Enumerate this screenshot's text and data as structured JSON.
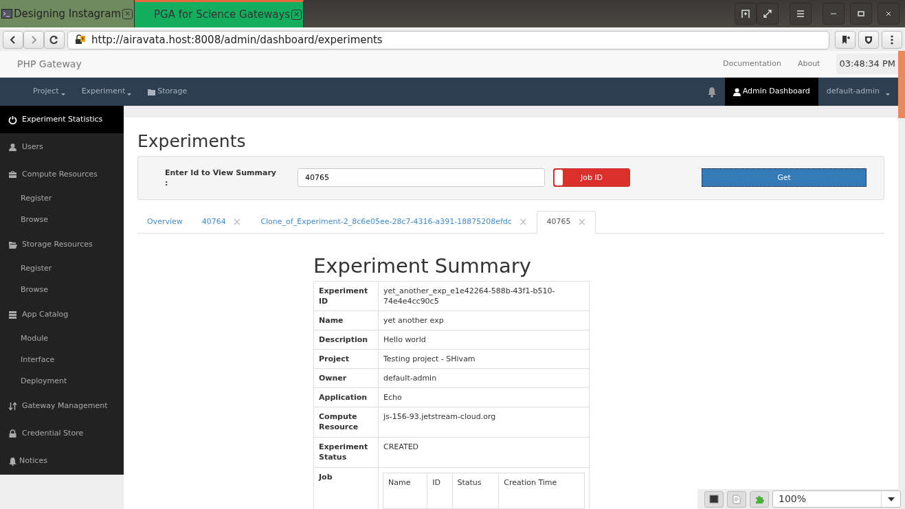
{
  "browser": {
    "tabs": [
      {
        "label": "Designing Instagram",
        "selected": false,
        "close": "×"
      },
      {
        "label": "PGA for Science Gateways",
        "selected": true,
        "close": "×"
      }
    ],
    "url": "http://airavata.host:8008/admin/dashboard/experiments"
  },
  "header": {
    "brand": "PHP Gateway",
    "links": [
      "Documentation",
      "About"
    ],
    "clock": "03:48:34 PM"
  },
  "navbar": {
    "left": [
      {
        "label": "Project",
        "kind": "dropdown"
      },
      {
        "label": "Experiment",
        "kind": "dropdown"
      },
      {
        "label": "Storage",
        "kind": "folder"
      }
    ],
    "right": [
      {
        "label": "Admin Dashboard",
        "kind": "user",
        "selected": true
      },
      {
        "label": "default-admin",
        "kind": "dropdown",
        "selected": false
      }
    ]
  },
  "sidebar": {
    "items": [
      {
        "label": "Experiment Statistics",
        "selected": true
      },
      {
        "label": "Users",
        "selected": false
      },
      {
        "label": "Compute Resources",
        "selected": false,
        "children": [
          {
            "label": "Register",
            "selected": false
          },
          {
            "label": "Browse",
            "selected": false
          }
        ]
      },
      {
        "label": "Storage Resources",
        "selected": false,
        "children": [
          {
            "label": "Register",
            "selected": false
          },
          {
            "label": "Browse",
            "selected": false
          }
        ]
      },
      {
        "label": "App Catalog",
        "selected": false,
        "children": [
          {
            "label": "Module",
            "selected": false
          },
          {
            "label": "Interface",
            "selected": false
          },
          {
            "label": "Deployment",
            "selected": false
          }
        ]
      },
      {
        "label": "Gateway Management",
        "selected": false
      },
      {
        "label": "Credential Store",
        "selected": false
      },
      {
        "label": "Notices",
        "selected": false
      }
    ]
  },
  "page": {
    "title": "Experiments",
    "search": {
      "label": "Enter Id to View Summary :",
      "value": "40765",
      "toggle": {
        "label": "Job ID",
        "on": false
      },
      "button": "Get"
    },
    "tabs": [
      {
        "label": "Overview",
        "selected": false
      },
      {
        "label": "40764",
        "selected": false,
        "close": "×"
      },
      {
        "label": "Clone_of_Experiment-2_8c6e05ee-28c7-4316-a391-18875208efdc",
        "selected": false,
        "close": "×"
      },
      {
        "label": "40765",
        "selected": true,
        "close": "×"
      }
    ],
    "summary": {
      "title": "Experiment Summary",
      "rows": [
        {
          "label": "Experiment ID",
          "value": "yet_another_exp_e1e42264-588b-43f1-b510-74e4e4cc90c5"
        },
        {
          "label": "Name",
          "value": "yet another exp"
        },
        {
          "label": "Description",
          "value": "Hello world"
        },
        {
          "label": "Project",
          "value": "Testing project - SHivam"
        },
        {
          "label": "Owner",
          "value": "default-admin"
        },
        {
          "label": "Application",
          "value": "Echo"
        },
        {
          "label": "Compute Resource",
          "value": "js-156-93.jetstream-cloud.org"
        },
        {
          "label": "Experiment Status",
          "value": "CREATED"
        }
      ],
      "job": {
        "label": "Job",
        "columns": [
          "Name",
          "ID",
          "Status",
          "Creation Time"
        ]
      }
    }
  },
  "zoom_bar": {
    "value": "100%"
  }
}
